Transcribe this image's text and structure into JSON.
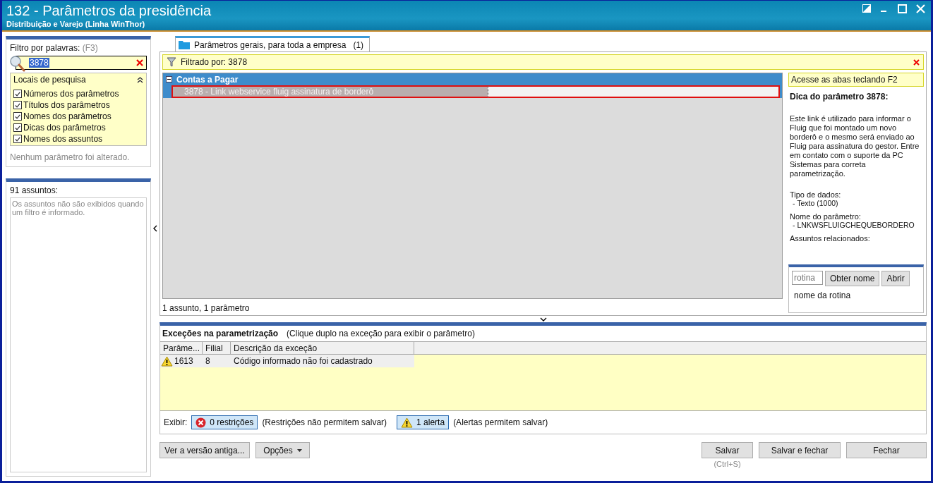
{
  "window": {
    "title": "132 - Parâmetros da presidência",
    "subtitle": "Distribuição e Varejo (Linha WinThor)"
  },
  "filter": {
    "label": "Filtro por palavras:",
    "hint": "(F3)",
    "value": "3878"
  },
  "search_locations": {
    "title": "Locais de pesquisa",
    "expanded": true,
    "items": [
      {
        "label": "Números dos parâmetros",
        "checked": true
      },
      {
        "label": "Títulos dos parâmetros",
        "checked": true
      },
      {
        "label": "Nomes dos parâmetros",
        "checked": true
      },
      {
        "label": "Dicas dos parâmetros",
        "checked": true
      },
      {
        "label": "Nomes dos assuntos",
        "checked": true
      }
    ]
  },
  "change_status": "Nenhum parâmetro foi alterado.",
  "subjects": {
    "label": "91 assuntos:",
    "message": "Os assuntos não são exibidos quando um filtro é informado."
  },
  "tabs": [
    {
      "label": "Parâmetros gerais, para toda a empresa",
      "count": "(1)",
      "selected": true
    }
  ],
  "filter_bar": {
    "text": "Filtrado por: 3878"
  },
  "tree": {
    "groups": [
      {
        "label": "Contas a Pagar",
        "expanded": true,
        "children": [
          {
            "label": "3878 - Link webservice fluig assinatura de borderô",
            "selected": true
          }
        ]
      }
    ]
  },
  "tree_status": "1 assunto, 1 parâmetro",
  "tip": {
    "hint_bar": "Acesse as abas teclando F2",
    "title": "Dica do parâmetro 3878:",
    "description": "Este link é utilizado para informar o Fluig que foi montado um novo borderô e o mesmo será enviado ao Fluig para assinatura do gestor. Entre em contato com o suporte da PC Sistemas para correta parametrização.",
    "sections": [
      {
        "label": "Tipo de dados:",
        "value": "- Texto (1000)"
      },
      {
        "label": "Nome do parâmetro:",
        "value": "- LNKWSFLUIGCHEQUEBORDERO"
      },
      {
        "label": "Assuntos relacionados:"
      }
    ]
  },
  "routine": {
    "placeholder": "rotina",
    "buttons": [
      "Obter nome",
      "Abrir"
    ],
    "result": "nome da rotina"
  },
  "exceptions": {
    "title": "Exceções na parametrização",
    "hint": "(Clique duplo na exceção para exibir o parâmetro)",
    "columns": [
      "Parâme...",
      "Filial",
      "Descrição da exceção"
    ],
    "rows": [
      {
        "kind": "alert",
        "param": "1613",
        "branch": "8",
        "description": "Código informado não foi cadastrado"
      }
    ]
  },
  "show": {
    "label": "Exibir:",
    "toggles": [
      {
        "kind": "restriction",
        "label": "0 restrições",
        "note": "(Restrições não permitem salvar)",
        "selected": true
      },
      {
        "kind": "alert",
        "label": "1 alerta",
        "note": "(Alertas permitem salvar)",
        "selected": true
      }
    ]
  },
  "footer": {
    "left": [
      {
        "label": "Ver a versão antiga...",
        "kind": "plain"
      },
      {
        "label": "Opções",
        "kind": "dropdown"
      }
    ],
    "right": [
      {
        "label": "Salvar",
        "shortcut": "(Ctrl+S)"
      },
      {
        "label": "Salvar e fechar"
      },
      {
        "label": "Fechar"
      }
    ]
  }
}
